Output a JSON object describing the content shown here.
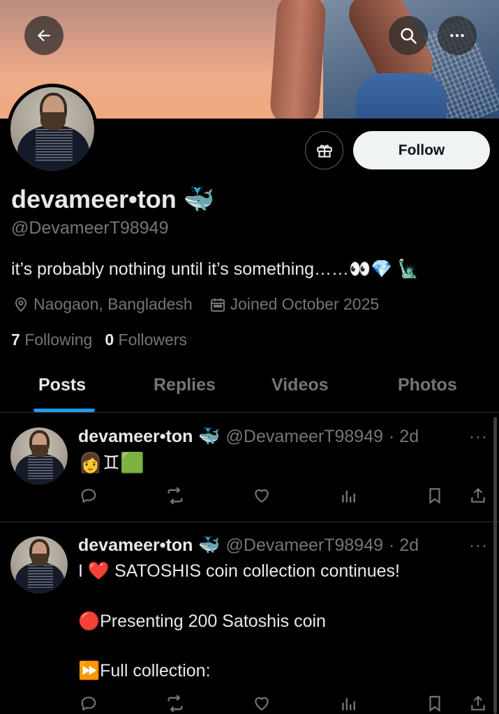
{
  "profile": {
    "display_name": "devameer•ton",
    "name_emoji": "🐳",
    "handle": "@DevameerT98949",
    "bio": "it’s probably nothing until it’s something……👀💎 🗽",
    "location": "Naogaon, Bangladesh",
    "joined": "Joined October 2025",
    "following_count": "7",
    "following_label": "Following",
    "followers_count": "0",
    "followers_label": "Followers",
    "follow_button": "Follow"
  },
  "tabs": [
    {
      "label": "Posts"
    },
    {
      "label": "Replies"
    },
    {
      "label": "Videos"
    },
    {
      "label": "Photos"
    }
  ],
  "posts": [
    {
      "name": "devameer•ton",
      "emoji": "🐳",
      "handle": "@DevameerT98949",
      "time": "· 2d",
      "lines": [
        "👩♊🟩"
      ]
    },
    {
      "name": "devameer•ton",
      "emoji": "🐳",
      "handle": "@DevameerT98949",
      "time": "· 2d",
      "lines": [
        "I ❤️ SATOSHIS coin collection continues!",
        "🔴Presenting 200 Satoshis coin",
        "⏩Full collection:"
      ]
    }
  ],
  "more_glyph": "···",
  "icons": {
    "back": "arrow-left-icon",
    "search": "search-icon",
    "more": "more-horizontal-icon",
    "gift": "gift-icon",
    "location": "location-pin-icon",
    "calendar": "calendar-icon",
    "reply": "reply-icon",
    "repost": "repost-icon",
    "like": "heart-icon",
    "views": "views-icon",
    "bookmark": "bookmark-icon",
    "share": "share-icon"
  },
  "colors": {
    "accent": "#1d9bf0",
    "background": "#000000",
    "text_primary": "#e7e9ea",
    "text_secondary": "#71767b",
    "divider": "#2f3336"
  }
}
